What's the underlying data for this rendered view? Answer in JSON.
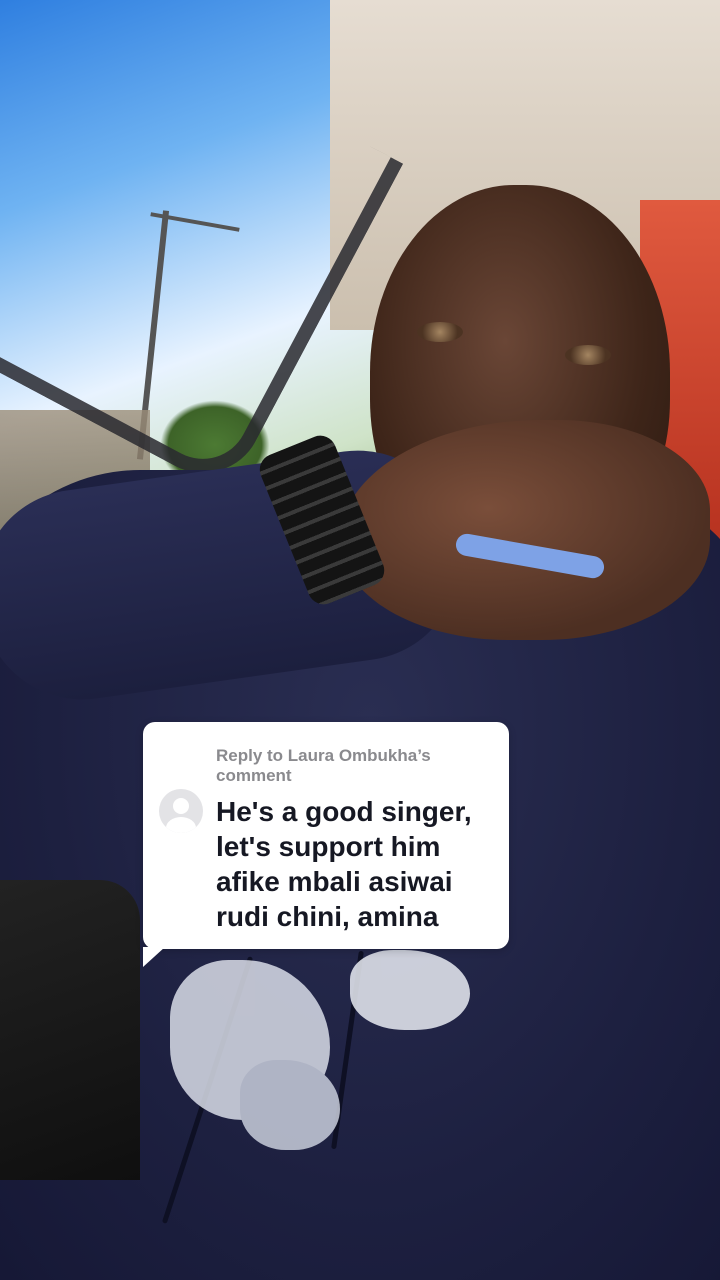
{
  "reply_sticker": {
    "prefix": "Reply to",
    "commenter": "Laura Ombukha’s",
    "suffix": "comment",
    "comment_text": "He's a good singer, let's support him afike mbali asiwai rudi chini, amina",
    "avatar_icon": "default-user-avatar"
  },
  "colors": {
    "card_background": "#ffffff",
    "header_text": "#8a8a8e",
    "comment_text": "#161823"
  }
}
